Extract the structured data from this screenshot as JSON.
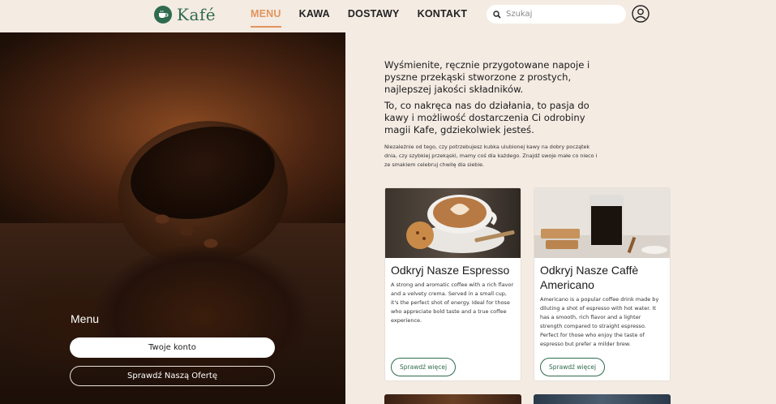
{
  "brand": {
    "name": "Kafé",
    "color": "#2f6b4f"
  },
  "nav": {
    "items": [
      {
        "label": "MENU",
        "active": true
      },
      {
        "label": "KAWA",
        "active": false
      },
      {
        "label": "DOSTAWY",
        "active": false
      },
      {
        "label": "KONTAKT",
        "active": false
      }
    ],
    "accent": "#e2955c"
  },
  "search": {
    "placeholder": "Szukaj"
  },
  "hero": {
    "title": "Menu",
    "primary_button": "Twoje konto",
    "secondary_button": "Sprawdź Naszą Ofertę"
  },
  "intro": {
    "p1": "Wyśmienite, ręcznie przygotowane napoje i pyszne przekąski stworzone z prostych, najlepszej jakości składników.",
    "p2": "To, co nakręca nas do działania, to pasja do kawy i możliwość dostarczenia Ci odrobiny magii Kafe, gdziekolwiek jesteś.",
    "p3": "Niezależnie od tego, czy potrzebujesz kubka ulubionej kawy na dobry początek dnia, czy szybkiej przekąski, mamy coś dla każdego. Znajdź swoje małe co nieco i ze smakiem celebruj chwilę dla siebie."
  },
  "cards": [
    {
      "title": "Odkryj Nasze Espresso",
      "description": "A strong and aromatic coffee with a rich flavor and a velvety crema. Served in a small cup, it's the perfect shot of energy. Ideal for those who appreciate bold taste and a true coffee experience.",
      "button": "Sprawdź więcej"
    },
    {
      "title": "Odkryj Nasze Caffè Americano",
      "description": "Americano is a popular coffee drink made by diluting a shot of espresso with hot water. It has a smooth, rich flavor and a lighter strength compared to straight espresso. Perfect for those who enjoy the taste of espresso but prefer a milder brew.",
      "button": "Sprawdź więcej"
    }
  ]
}
